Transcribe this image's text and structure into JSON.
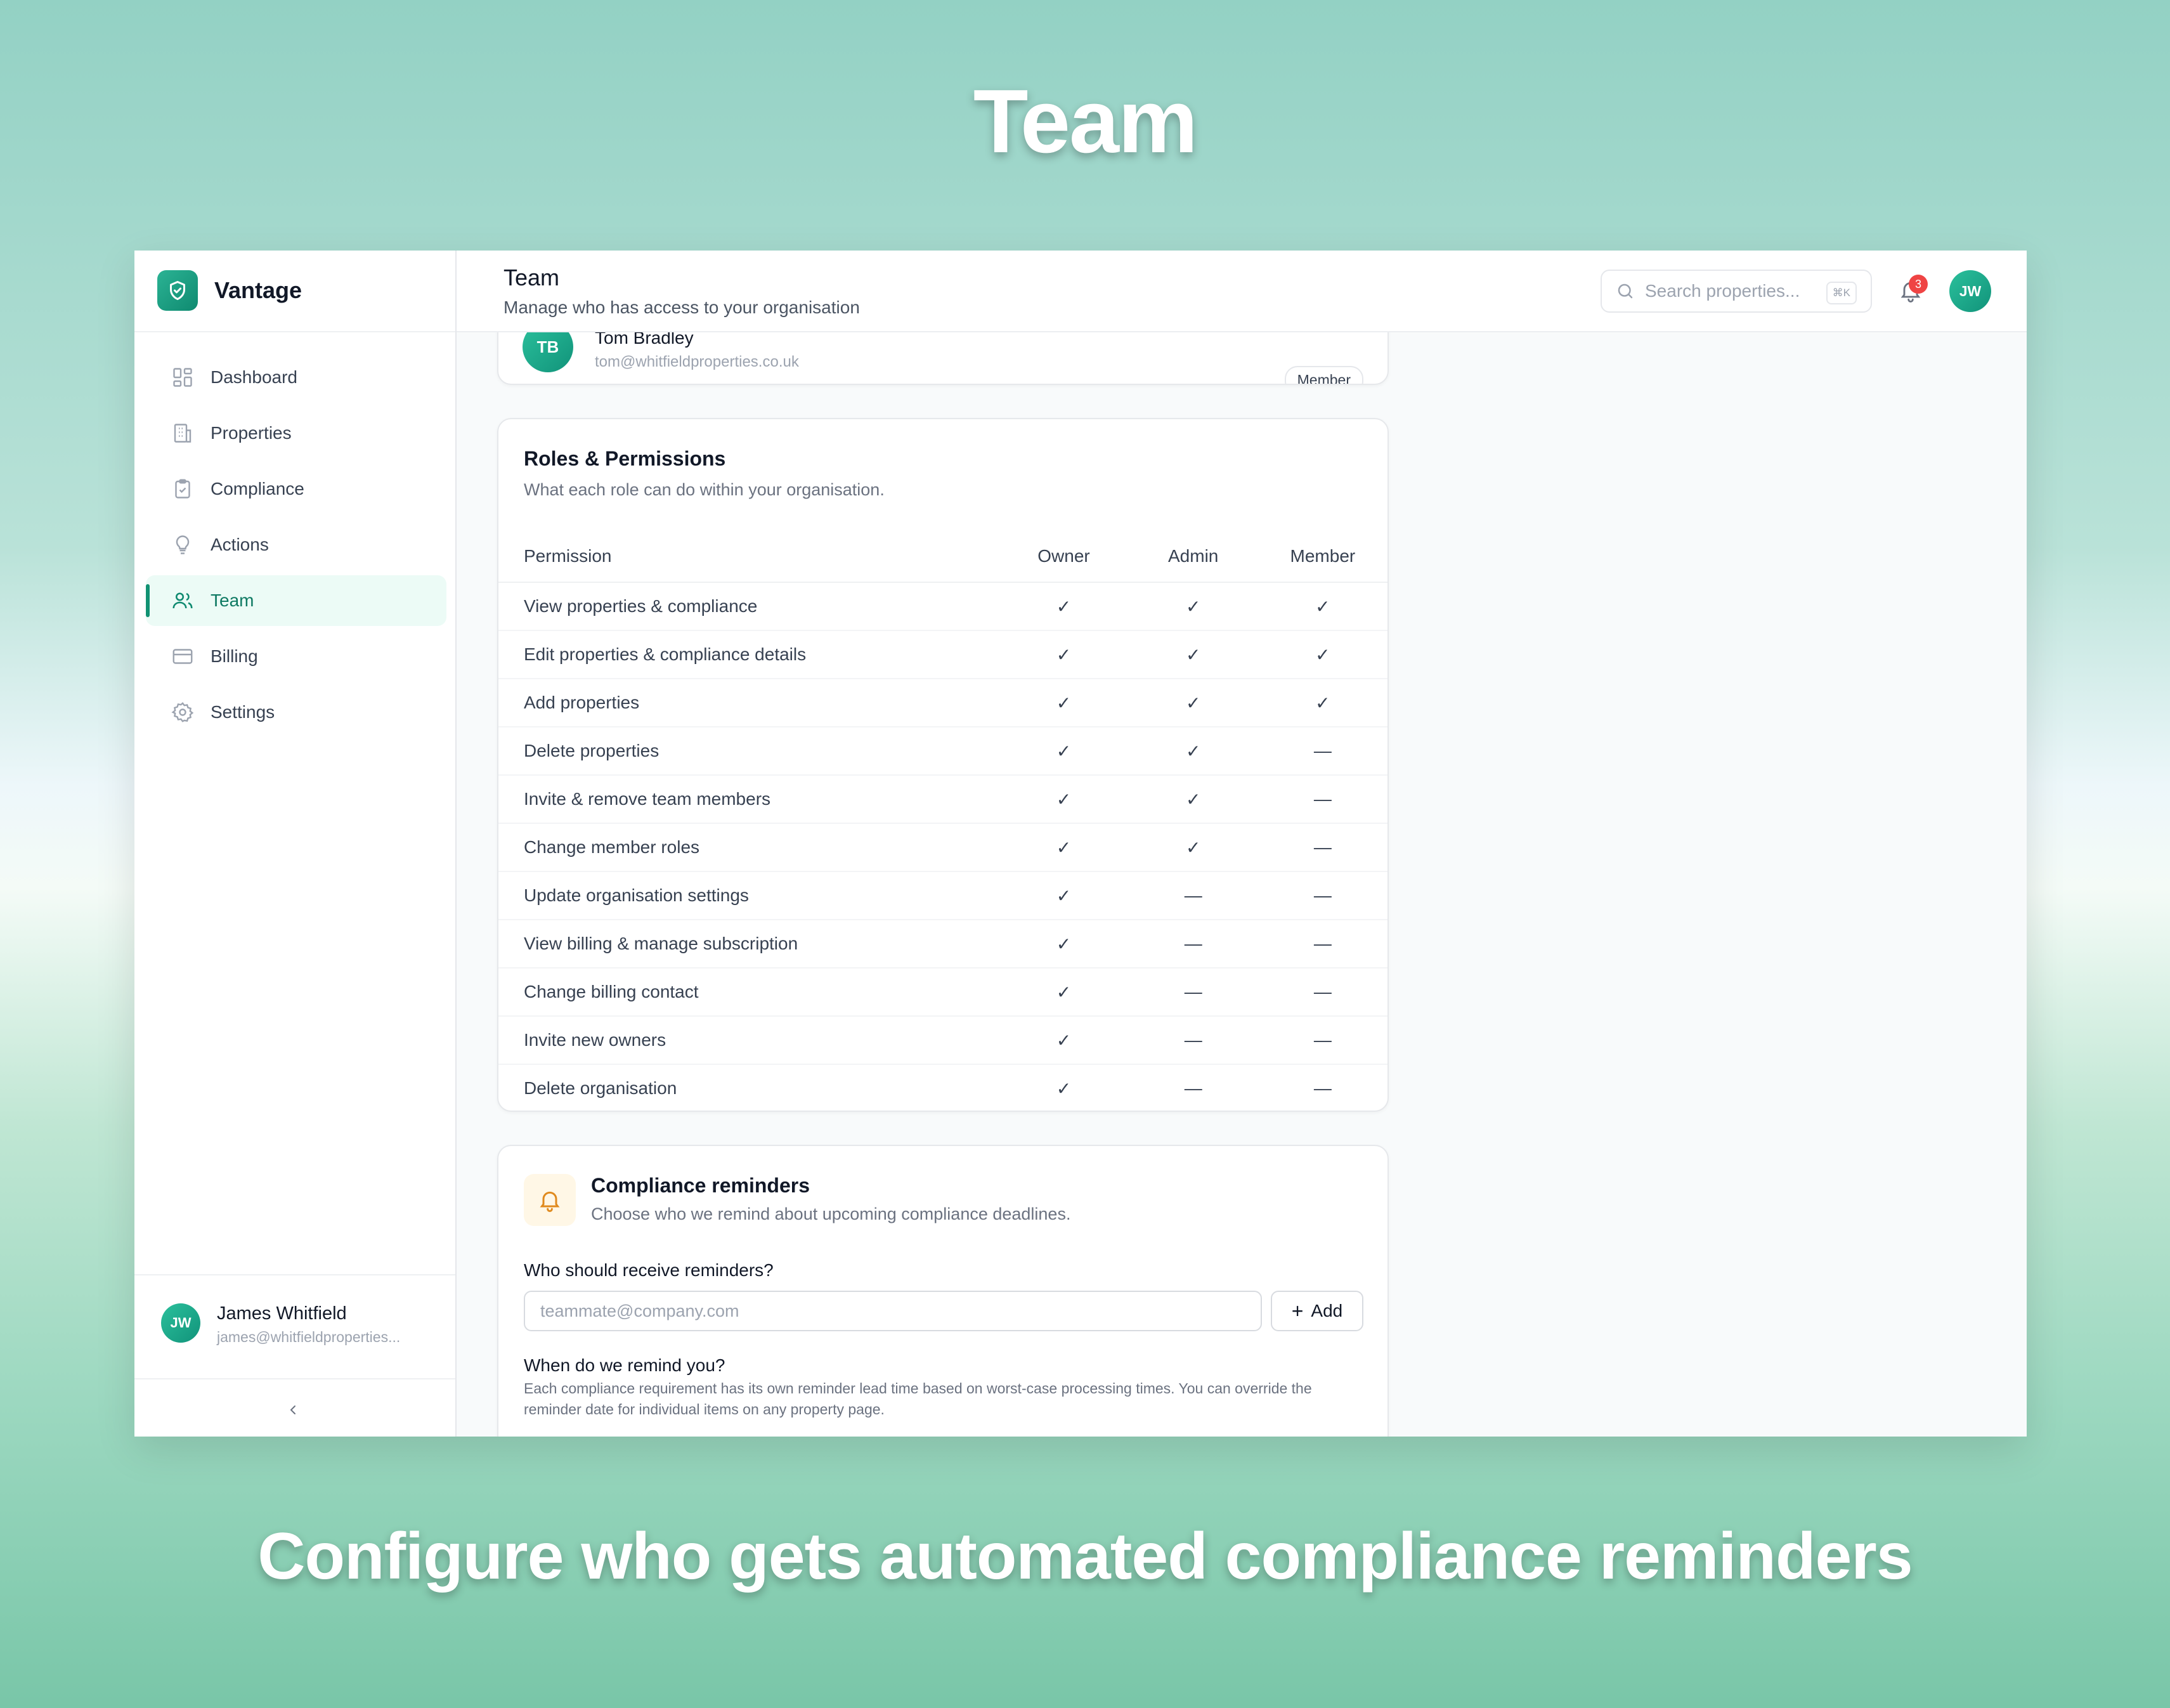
{
  "marketing": {
    "headline": "Team",
    "caption": "Configure who gets automated compliance reminders"
  },
  "app": {
    "name": "Vantage",
    "brand_color": "#119273"
  },
  "sidebar": {
    "items": [
      {
        "label": "Dashboard",
        "icon": "grid-icon"
      },
      {
        "label": "Properties",
        "icon": "building-icon"
      },
      {
        "label": "Compliance",
        "icon": "clipboard-check-icon"
      },
      {
        "label": "Actions",
        "icon": "lightbulb-icon"
      },
      {
        "label": "Team",
        "icon": "users-icon",
        "active": true
      },
      {
        "label": "Billing",
        "icon": "credit-card-icon"
      },
      {
        "label": "Settings",
        "icon": "gear-icon"
      }
    ],
    "user": {
      "initials": "JW",
      "name": "James Whitfield",
      "email": "james@whitfieldproperties..."
    }
  },
  "header": {
    "title": "Team",
    "subtitle": "Manage who has access to your organisation",
    "search_placeholder": "Search properties...",
    "search_shortcut": "⌘K",
    "notification_count": "3",
    "avatar_initials": "JW"
  },
  "member": {
    "initials": "TB",
    "name": "Tom Bradley",
    "email": "tom@whitfieldproperties.co.uk",
    "role": "Member"
  },
  "roles": {
    "title": "Roles & Permissions",
    "subtitle": "What each role can do within your organisation.",
    "columns": [
      "Permission",
      "Owner",
      "Admin",
      "Member"
    ],
    "rows": [
      {
        "permission": "View properties & compliance",
        "owner": "✓",
        "admin": "✓",
        "member": "✓"
      },
      {
        "permission": "Edit properties & compliance details",
        "owner": "✓",
        "admin": "✓",
        "member": "✓"
      },
      {
        "permission": "Add properties",
        "owner": "✓",
        "admin": "✓",
        "member": "✓"
      },
      {
        "permission": "Delete properties",
        "owner": "✓",
        "admin": "✓",
        "member": "—"
      },
      {
        "permission": "Invite & remove team members",
        "owner": "✓",
        "admin": "✓",
        "member": "—"
      },
      {
        "permission": "Change member roles",
        "owner": "✓",
        "admin": "✓",
        "member": "—"
      },
      {
        "permission": "Update organisation settings",
        "owner": "✓",
        "admin": "—",
        "member": "—"
      },
      {
        "permission": "View billing & manage subscription",
        "owner": "✓",
        "admin": "—",
        "member": "—"
      },
      {
        "permission": "Change billing contact",
        "owner": "✓",
        "admin": "—",
        "member": "—"
      },
      {
        "permission": "Invite new owners",
        "owner": "✓",
        "admin": "—",
        "member": "—"
      },
      {
        "permission": "Delete organisation",
        "owner": "✓",
        "admin": "—",
        "member": "—"
      }
    ]
  },
  "reminders": {
    "title": "Compliance reminders",
    "subtitle": "Choose who we remind about upcoming compliance deadlines.",
    "recipients_label": "Who should receive reminders?",
    "input_placeholder": "teammate@company.com",
    "add_label": "Add",
    "when_label": "When do we remind you?",
    "help_text": "Each compliance requirement has its own reminder lead time based on worst-case processing times. You can override the reminder date for individual items on any property page."
  }
}
